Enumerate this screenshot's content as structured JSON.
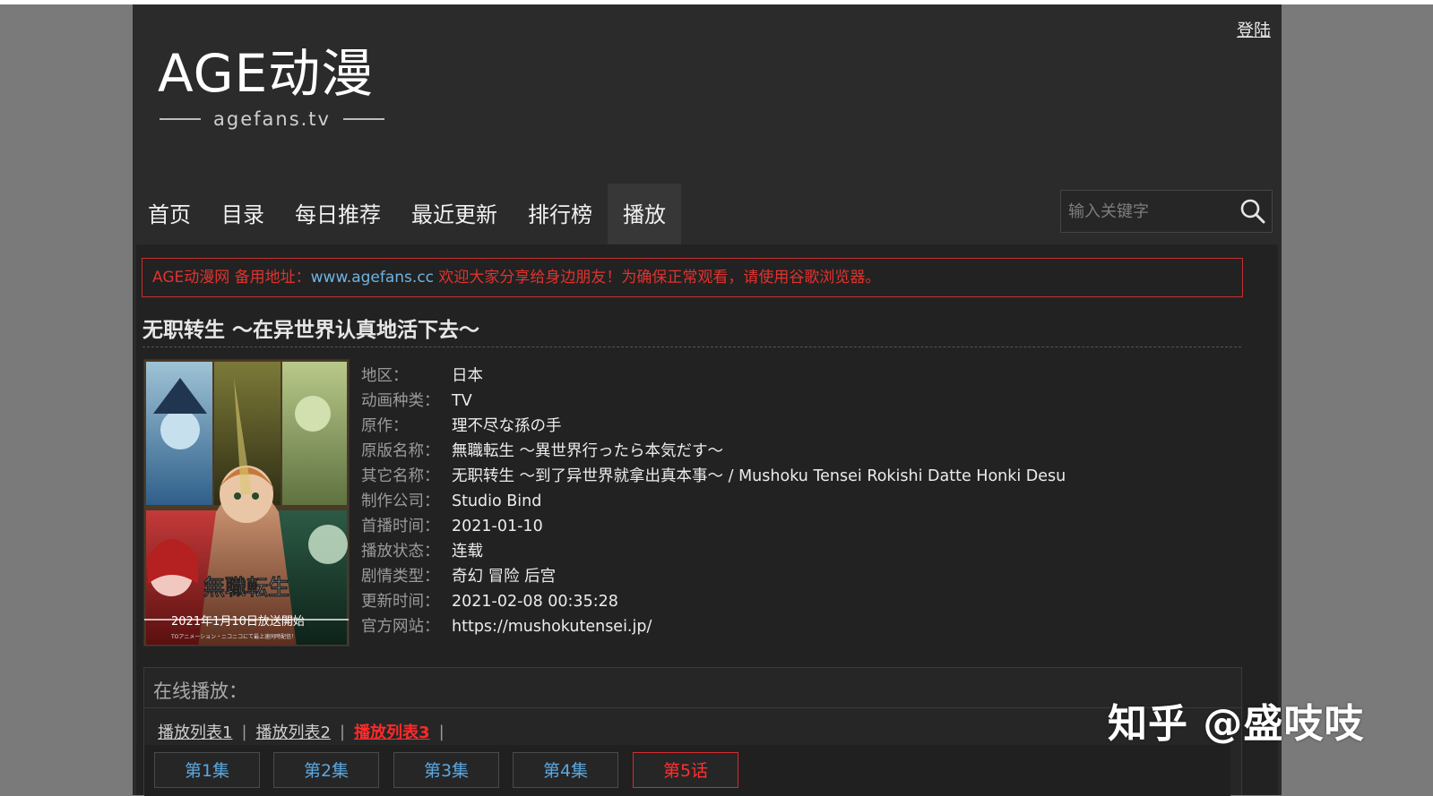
{
  "header": {
    "login_label": "登陆",
    "logo_text": "AGE动漫",
    "logo_sub": "agefans.tv"
  },
  "nav": {
    "items": [
      "首页",
      "目录",
      "每日推荐",
      "最近更新",
      "排行榜",
      "播放"
    ],
    "active": "播放"
  },
  "search": {
    "placeholder": "输入关键字",
    "value": ""
  },
  "notice": {
    "prefix": "AGE动漫网 备用地址：",
    "link": "www.agefans.cc",
    "suffix": " 欢迎大家分享给身边朋友！为确保正常观看，请使用谷歌浏览器。"
  },
  "anime": {
    "title": "无职转生 ～在异世界认真地活下去～",
    "info": [
      {
        "label": "地区：",
        "value": "日本"
      },
      {
        "label": "动画种类：",
        "value": "TV"
      },
      {
        "label": "原作：",
        "value": "理不尽な孫の手"
      },
      {
        "label": "原版名称：",
        "value": "無職転生 ～異世界行ったら本気だす～"
      },
      {
        "label": "其它名称：",
        "value": "无职转生 ～到了异世界就拿出真本事～ / Mushoku Tensei Rokishi Datte Honki Desu"
      },
      {
        "label": "制作公司：",
        "value": "Studio Bind"
      },
      {
        "label": "首播时间：",
        "value": "2021-01-10"
      },
      {
        "label": "播放状态：",
        "value": "连载"
      },
      {
        "label": "剧情类型：",
        "value": "奇幻 冒险 后宫"
      },
      {
        "label": "更新时间：",
        "value": "2021-02-08 00:35:28"
      },
      {
        "label": "官方网站：",
        "value": "https://mushokutensei.jp/"
      }
    ],
    "poster": {
      "title_text": "無職転生",
      "date_text": "2021年1月10日放送開始",
      "caption": "TOアニメーション・ニコニコにて最上速同時配信！"
    }
  },
  "online": {
    "title": "在线播放：",
    "playlists": [
      "播放列表1",
      "播放列表2",
      "播放列表3"
    ],
    "active_playlist": "播放列表3",
    "episodes": [
      "第1集",
      "第2集",
      "第3集",
      "第4集",
      "第5话"
    ],
    "active_episode": "第5话"
  },
  "watermark": "知乎 @盛吱吱",
  "colors": {
    "notice_red": "#e0332e",
    "link_blue": "#6fb3e0",
    "episode_blue": "#5aa8e0",
    "active_red": "#ff2a2a"
  }
}
